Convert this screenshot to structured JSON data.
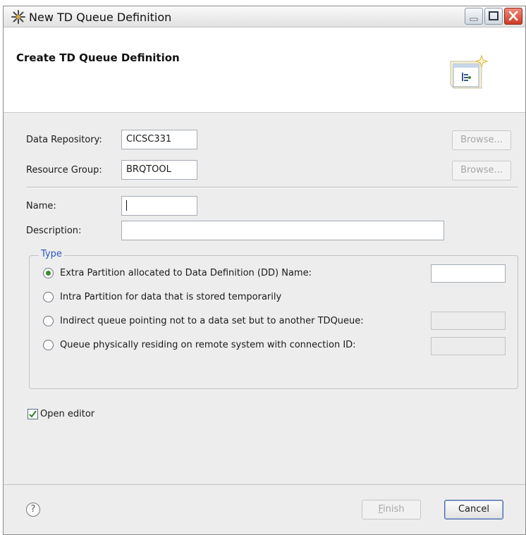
{
  "window": {
    "title": "New TD Queue Definition"
  },
  "header": {
    "title": "Create TD Queue Definition"
  },
  "form": {
    "data_repository": {
      "label": "Data Repository:",
      "value": "CICSC331",
      "browse_label": "Browse..."
    },
    "resource_group": {
      "label": "Resource Group:",
      "value": "BRQTOOL",
      "browse_label": "Browse..."
    },
    "name": {
      "label": "Name:",
      "value": ""
    },
    "description": {
      "label": "Description:",
      "value": ""
    }
  },
  "type_group": {
    "title": "Type",
    "options": [
      {
        "label": "Extra Partition allocated to Data Definition (DD) Name:",
        "selected": true,
        "field_enabled": true,
        "value": ""
      },
      {
        "label": "Intra Partition for data that is stored temporarily",
        "selected": false
      },
      {
        "label": "Indirect queue pointing not to a data set but to another TDQueue:",
        "selected": false,
        "field_enabled": false,
        "value": ""
      },
      {
        "label": "Queue physically residing on remote system with connection ID:",
        "selected": false,
        "field_enabled": false,
        "value": ""
      }
    ]
  },
  "open_editor": {
    "label": "Open editor",
    "checked": true
  },
  "footer": {
    "help_icon_glyph": "?",
    "finish_mnemonic": "F",
    "finish_rest": "inish",
    "cancel_label": "Cancel"
  },
  "colors": {
    "group_title": "#2a56c6",
    "radio_selected": "#3b8a2f",
    "checkmark": "#2f7d24",
    "close_button": "#cc3b26"
  }
}
